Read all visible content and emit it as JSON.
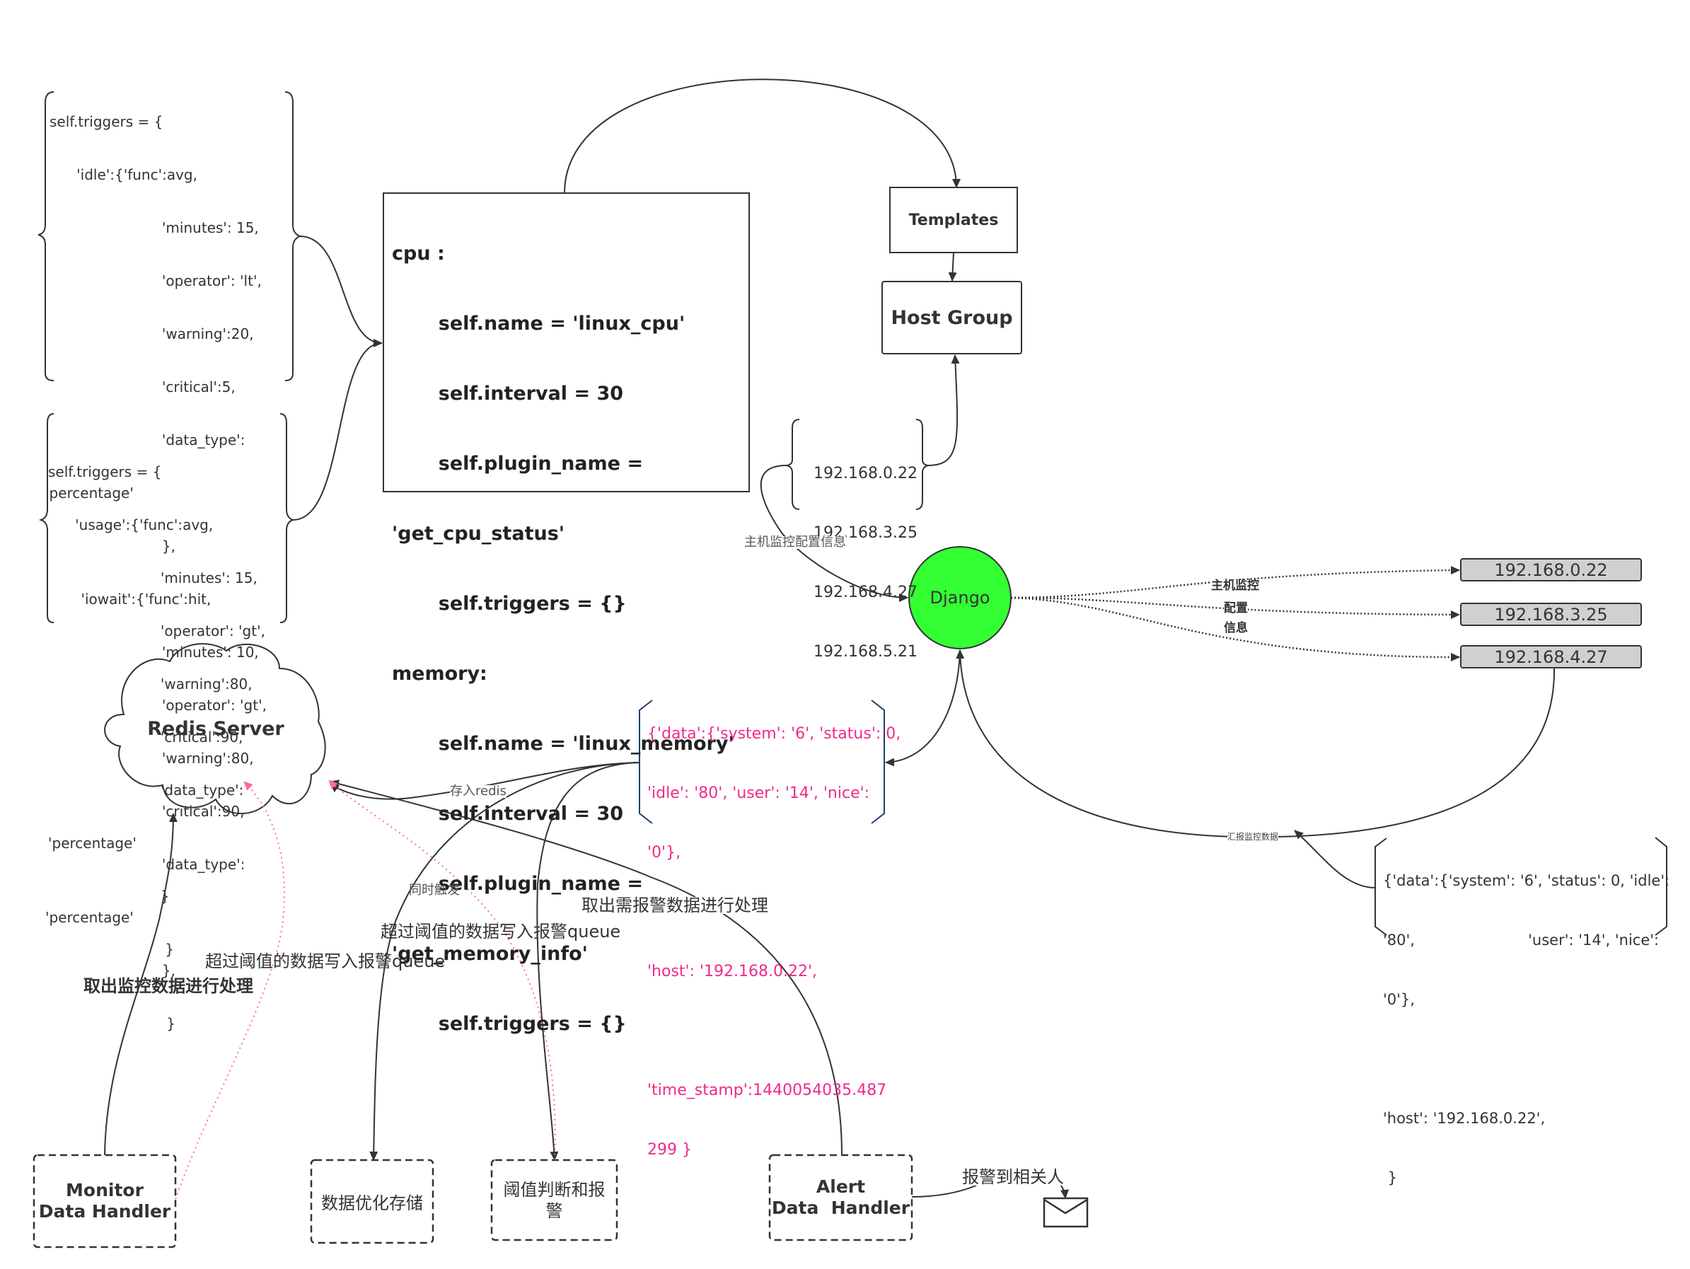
{
  "cpu_triggers": {
    "lines": [
      "self.triggers = {",
      "      'idle':{'func':avg,",
      "                         'minutes': 15,",
      "                         'operator': 'lt',",
      "                         'warning':20,",
      "                         'critical':5,",
      "                         'data_type':",
      "'percentage'",
      "                         },",
      "       'iowait':{'func':hit,",
      "                         'minutes': 10,",
      "                         'operator': 'gt',",
      "                         'warning':80,",
      "                         'critical':90,",
      "                         'data_type':",
      "'percentage'",
      "                         },",
      "                          }"
    ]
  },
  "memory_triggers": {
    "lines": [
      "self.triggers = {",
      "      'usage':{'func':avg,",
      "                         'minutes': 15,",
      "                         'operator': 'gt',",
      "                         'warning':80,",
      "                         'critical':90,",
      "                         'data_type':",
      "'percentage'",
      "                         }",
      "                          }"
    ]
  },
  "plugin_box": {
    "lines": [
      "cpu :",
      "       self.name = 'linux_cpu'",
      "       self.interval = 30",
      "       self.plugin_name =",
      "'get_cpu_status'",
      "       self.triggers = {}",
      "memory:",
      "       self.name = 'linux_memory'",
      "       self.interval = 30",
      "       self.plugin_name =",
      "'get_memory_info'",
      "       self.triggers = {}"
    ]
  },
  "nodes": {
    "templates": "Templates",
    "host_group": "Host Group",
    "django": "Django",
    "redis": "Redis Server",
    "monitor_handler": "Monitor\nData Handler",
    "data_storage": "数据优化存储",
    "threshold_alert": "阈值判断和报\n警",
    "alert_handler": "Alert\nData  Handler"
  },
  "host_group_ips": [
    "192.168.0.22",
    "192.168.3.25",
    "192.168.4.27",
    "192.168.5.21"
  ],
  "hosts": [
    "192.168.0.22",
    "192.168.3.25",
    "192.168.4.27"
  ],
  "django_payload": {
    "lines": [
      "{'data':{'system': '6', 'status': 0,",
      "'idle': '80', 'user': '14', 'nice':",
      "'0'},",
      "",
      "'host': '192.168.0.22',",
      "",
      "'time_stamp':1440054035.487",
      "299 }"
    ]
  },
  "report_payload": {
    "lines": [
      "{'data':{'system': '6', 'status': 0, 'idle':",
      "'80',                        'user': '14', 'nice':",
      "'0'},",
      "",
      "'host': '192.168.0.22',",
      " }"
    ]
  },
  "edge_labels": {
    "host_config_info": "主机监控配置信息",
    "push_line1": "主机监控",
    "push_line2": "配置",
    "push_line3": "信息",
    "report_data": "汇报监控数据",
    "save_redis": "存入redis",
    "simultaneous": "同时触发",
    "write_alert_queue_1": "超过阈值的数据写入报警queue",
    "write_alert_queue_2": "超过阈值的数据写入报警queue",
    "fetch_alert_data": "取出需报警数据进行处理",
    "fetch_monitor_data": "取出监控数据进行处理",
    "notify_people": "报警到相关人"
  },
  "icons": {
    "mail": "envelope-icon"
  },
  "colors": {
    "django_fill": "#33ff33",
    "host_fill": "#d0d0d0",
    "payload_text": "#ee2a8a",
    "payload_brace": "#1f3f6e",
    "dotted_pink": "#ff66aa",
    "stroke": "#333333"
  }
}
